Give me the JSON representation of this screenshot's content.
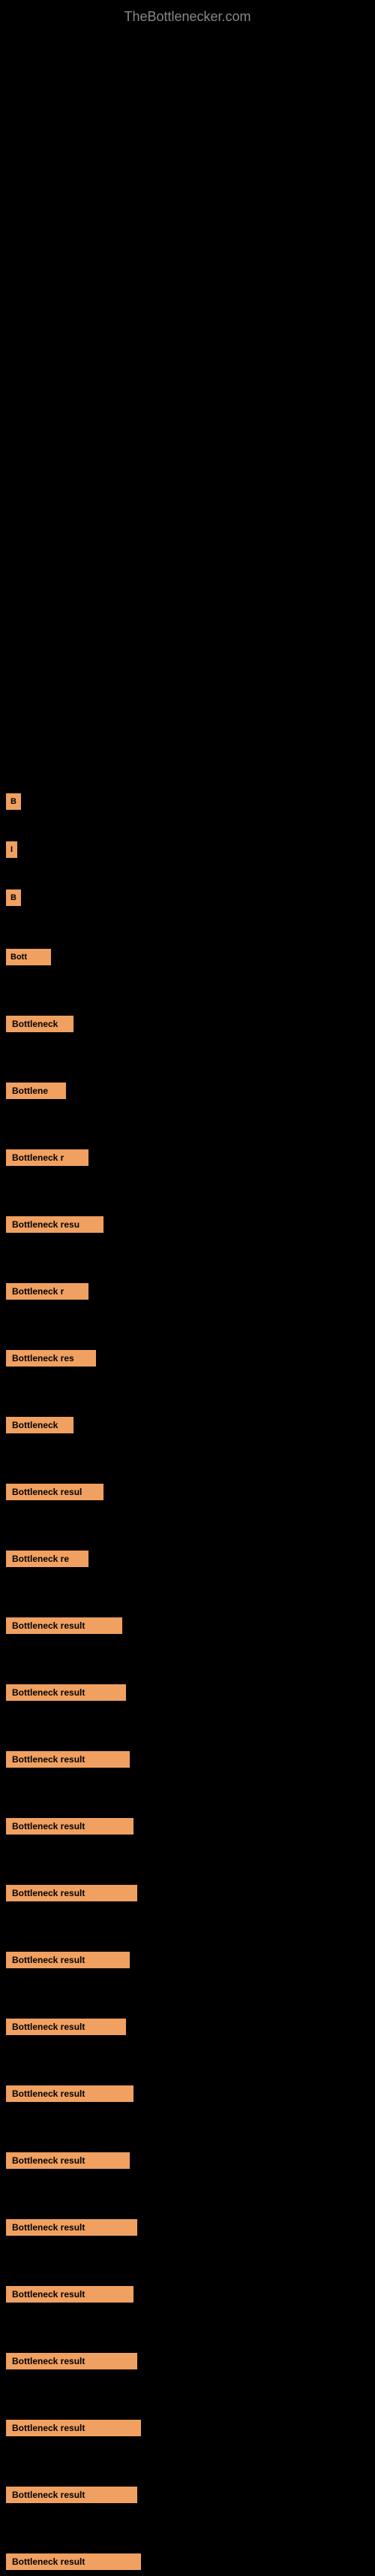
{
  "site": {
    "title": "TheBottlenecker.com"
  },
  "items": [
    {
      "label": "B",
      "class": "item-0"
    },
    {
      "label": "I",
      "class": "item-1"
    },
    {
      "label": "B",
      "class": "item-2"
    },
    {
      "label": "Bott",
      "class": "item-3"
    },
    {
      "label": "Bottleneck",
      "class": "item-4"
    },
    {
      "label": "Bottlene",
      "class": "item-5"
    },
    {
      "label": "Bottleneck r",
      "class": "item-6"
    },
    {
      "label": "Bottleneck resu",
      "class": "item-7"
    },
    {
      "label": "Bottleneck r",
      "class": "item-8"
    },
    {
      "label": "Bottleneck res",
      "class": "item-9"
    },
    {
      "label": "Bottleneck",
      "class": "item-10"
    },
    {
      "label": "Bottleneck resul",
      "class": "item-11"
    },
    {
      "label": "Bottleneck re",
      "class": "item-12"
    },
    {
      "label": "Bottleneck result",
      "class": "item-13"
    },
    {
      "label": "Bottleneck result",
      "class": "item-14"
    },
    {
      "label": "Bottleneck result",
      "class": "item-15"
    },
    {
      "label": "Bottleneck result",
      "class": "item-16"
    },
    {
      "label": "Bottleneck result",
      "class": "item-17"
    },
    {
      "label": "Bottleneck result",
      "class": "item-18"
    },
    {
      "label": "Bottleneck result",
      "class": "item-19"
    },
    {
      "label": "Bottleneck result",
      "class": "item-20"
    },
    {
      "label": "Bottleneck result",
      "class": "item-21"
    },
    {
      "label": "Bottleneck result",
      "class": "item-22"
    },
    {
      "label": "Bottleneck result",
      "class": "item-23"
    },
    {
      "label": "Bottleneck result",
      "class": "item-24"
    },
    {
      "label": "Bottleneck result",
      "class": "item-25"
    },
    {
      "label": "Bottleneck result",
      "class": "item-26"
    },
    {
      "label": "Bottleneck result",
      "class": "item-27"
    }
  ]
}
